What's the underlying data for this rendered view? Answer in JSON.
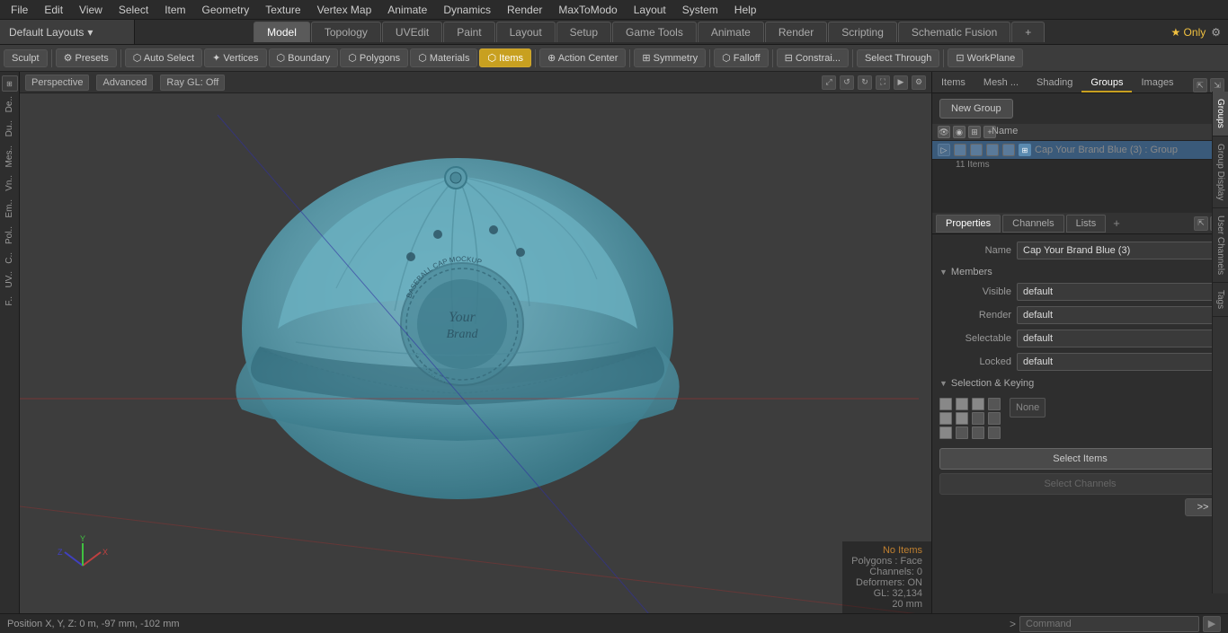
{
  "menubar": {
    "items": [
      "File",
      "Edit",
      "View",
      "Select",
      "Item",
      "Geometry",
      "Texture",
      "Vertex Map",
      "Animate",
      "Dynamics",
      "Render",
      "MaxToModo",
      "Layout",
      "System",
      "Help"
    ]
  },
  "layout": {
    "selector": "Default Layouts",
    "selector_arrow": "▾",
    "tabs": [
      "Model",
      "Topology",
      "UVEdit",
      "Paint",
      "Layout",
      "Setup",
      "Game Tools",
      "Animate",
      "Render",
      "Scripting",
      "Schematic Fusion"
    ],
    "active_tab": "Model",
    "right_label": "★  Only",
    "add_icon": "+"
  },
  "toolbar": {
    "sculpt_label": "Sculpt",
    "presets_label": "⚙ Presets",
    "auto_select_label": "⬡ Auto Select",
    "vertices_label": "✦ Vertices",
    "boundary_label": "⬡ Boundary",
    "polygons_label": "⬡ Polygons",
    "materials_label": "⬡ Materials",
    "items_label": "⬡ Items",
    "action_center_label": "⊕ Action Center",
    "symmetry_label": "⊞ Symmetry",
    "falloff_label": "⬡ Falloff",
    "constrain_label": "⊟ Constrai...",
    "select_through_label": "Select Through",
    "workplane_label": "⊡ WorkPlane"
  },
  "viewport": {
    "perspective_label": "Perspective",
    "advanced_label": "Advanced",
    "ray_gl_label": "Ray GL: Off",
    "icons": [
      "⤢",
      "↺",
      "↻",
      "⛶",
      "▶",
      "⚙"
    ]
  },
  "viewport_status": {
    "no_items": "No Items",
    "polygons_face": "Polygons : Face",
    "channels": "Channels: 0",
    "deformers": "Deformers: ON",
    "gl": "GL: 32,134",
    "mm": "20 mm"
  },
  "right_panel": {
    "tabs": [
      "Items",
      "Mesh ...",
      "Shading",
      "Groups",
      "Images"
    ],
    "active_tab": "Groups",
    "expand_icon": "⇱",
    "new_group_label": "New Group",
    "name_col": "Name",
    "group_name": "Cap Your Brand Blue",
    "group_number": "(3)",
    "group_suffix": ": Group",
    "group_items": "11 Items"
  },
  "properties": {
    "tabs": [
      "Properties",
      "Channels",
      "Lists"
    ],
    "active_tab": "Properties",
    "add_tab": "+",
    "name_label": "Name",
    "name_value": "Cap Your Brand Blue (3)",
    "members_section": "Members",
    "visible_label": "Visible",
    "visible_value": "default",
    "render_label": "Render",
    "render_value": "default",
    "selectable_label": "Selectable",
    "selectable_value": "default",
    "locked_label": "Locked",
    "locked_value": "default",
    "selection_section": "Selection & Keying",
    "none_label": "None",
    "select_items_btn": "Select Items",
    "select_channels_btn": "Select Channels",
    "forward_btn": ">>"
  },
  "vert_tabs": [
    "Groups",
    "Group Display",
    "User Channels",
    "Tags"
  ],
  "bottom_bar": {
    "position_label": "Position X, Y, Z:",
    "position_value": "0 m, -97 mm, -102 mm",
    "command_arrow": ">",
    "command_placeholder": "Command"
  },
  "left_sidebar": {
    "items": [
      "De..",
      "Du..",
      "Mes..",
      "Vn..",
      "Em..",
      "Pol..",
      "C..",
      "UV..",
      "F.."
    ]
  }
}
